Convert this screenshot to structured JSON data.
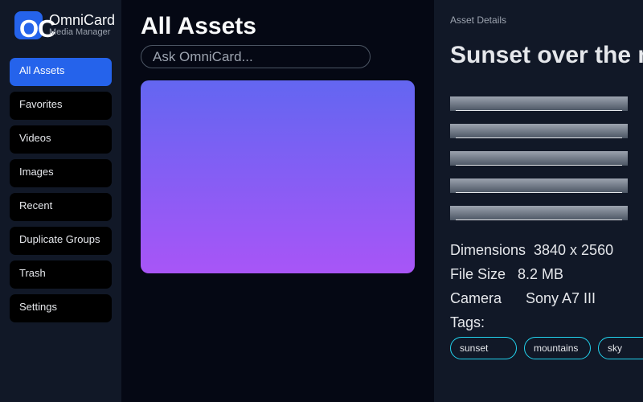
{
  "sidebar": {
    "logo": "OC",
    "app_name": "OmniCard",
    "app_subtitle": "Media Manager",
    "items": [
      {
        "label": "All Assets"
      },
      {
        "label": "Favorites"
      },
      {
        "label": "Videos"
      },
      {
        "label": "Images"
      },
      {
        "label": "Recent"
      },
      {
        "label": "Duplicate Groups"
      },
      {
        "label": "Trash"
      },
      {
        "label": "Settings"
      }
    ]
  },
  "main": {
    "title": "All Assets",
    "search_placeholder": "Ask OmniCard..."
  },
  "details": {
    "section_label": "Asset Details",
    "title": "Sunset over the mountains",
    "meta": [
      {
        "key": "Dimensions",
        "value": "3840 x 2560"
      },
      {
        "key": "File Size",
        "value": "8.2 MB"
      },
      {
        "key": "Camera",
        "value": "Sony A7 III"
      }
    ],
    "tags_label": "Tags:",
    "tags": [
      "sunset",
      "mountains",
      "sky"
    ]
  },
  "colors": {
    "accent": "#2563eb",
    "tag_border": "#22d3ee",
    "gradient_top": "#6366f1",
    "gradient_bottom": "#a855f7"
  }
}
